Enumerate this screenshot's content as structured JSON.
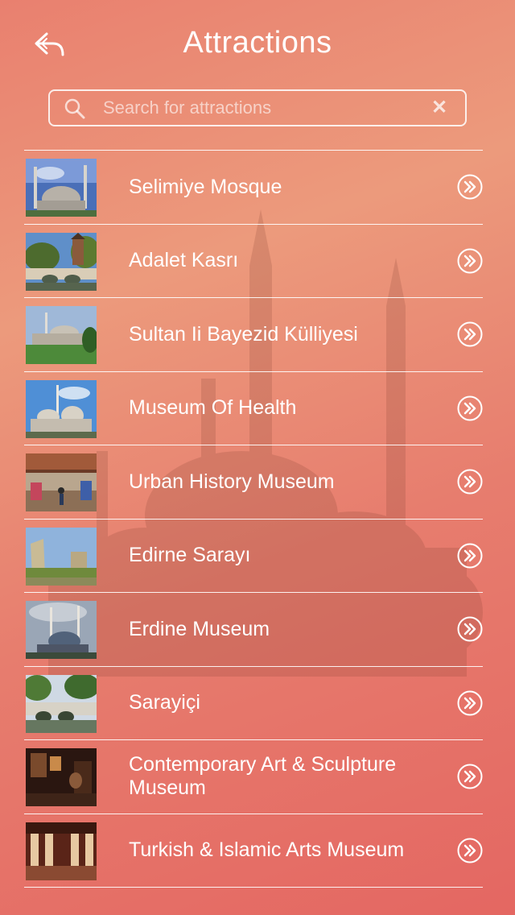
{
  "header": {
    "title": "Attractions",
    "back_icon": "back-arrow-icon"
  },
  "search": {
    "placeholder": "Search for attractions",
    "value": "",
    "clear_glyph": "✕"
  },
  "attractions": [
    {
      "name": "Selimiye Mosque",
      "thumb": "mosque-blue-sky"
    },
    {
      "name": "Adalet Kasrı",
      "thumb": "bridge-tower"
    },
    {
      "name": "Sultan Ii Bayezid Külliyesi",
      "thumb": "complex-green-field"
    },
    {
      "name": "Museum Of Health",
      "thumb": "domes-blue-sky"
    },
    {
      "name": "Urban History Museum",
      "thumb": "bazaar-interior"
    },
    {
      "name": "Edirne Sarayı",
      "thumb": "ruins-grass"
    },
    {
      "name": "Erdine Museum",
      "thumb": "mosque-cloudy"
    },
    {
      "name": "Sarayiçi",
      "thumb": "stone-bridge-river"
    },
    {
      "name": "Contemporary Art & Sculpture Museum",
      "thumb": "dark-gallery"
    },
    {
      "name": "Turkish & Islamic Arts Museum",
      "thumb": "museum-hall"
    }
  ],
  "colors": {
    "gradient_top": "#e9806f",
    "gradient_bottom": "#e46762",
    "text": "#ffffff"
  }
}
